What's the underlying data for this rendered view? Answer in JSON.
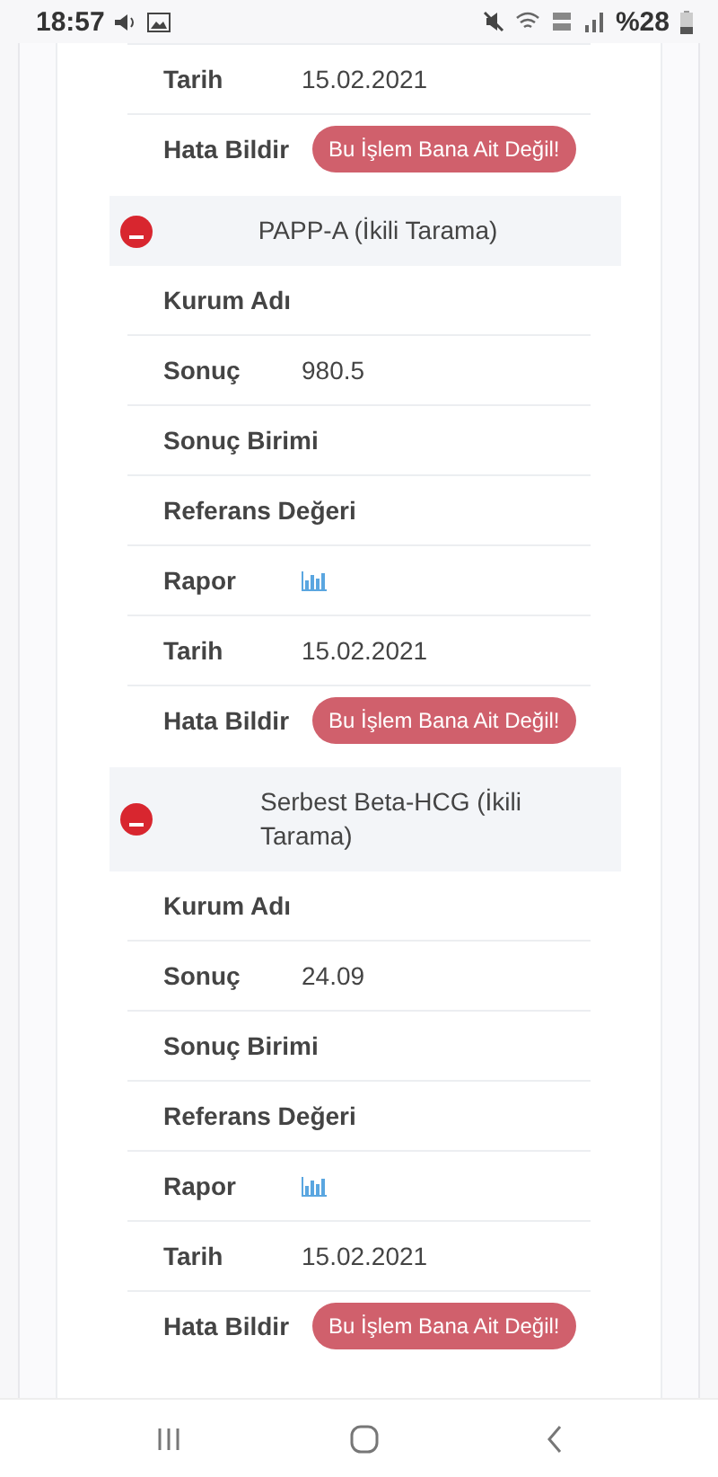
{
  "status_bar": {
    "time": "18:57",
    "battery": "%28"
  },
  "sections": [
    {
      "rows": [
        {
          "kind": "text",
          "label": "Tarih",
          "value": "15.02.2021"
        },
        {
          "kind": "button",
          "label": "Hata Bildir",
          "value": "Bu İşlem Bana Ait Değil!"
        }
      ]
    },
    {
      "title": "PAPP-A (İkili Tarama)",
      "expanded": true,
      "rows": [
        {
          "kind": "text",
          "label": "Kurum Adı",
          "value": null
        },
        {
          "kind": "text",
          "label": "Sonuç",
          "value": "980.5"
        },
        {
          "kind": "text",
          "label": "Sonuç Birimi",
          "value": null
        },
        {
          "kind": "text",
          "label": "Referans Değeri",
          "value": null
        },
        {
          "kind": "chart",
          "label": "Rapor",
          "value": null
        },
        {
          "kind": "text",
          "label": "Tarih",
          "value": "15.02.2021"
        },
        {
          "kind": "button",
          "label": "Hata Bildir",
          "value": "Bu İşlem Bana Ait Değil!"
        }
      ]
    },
    {
      "title": "Serbest Beta-HCG (İkili Tarama)",
      "expanded": true,
      "rows": [
        {
          "kind": "text",
          "label": "Kurum Adı",
          "value": null
        },
        {
          "kind": "text",
          "label": "Sonuç",
          "value": "24.09"
        },
        {
          "kind": "text",
          "label": "Sonuç Birimi",
          "value": null
        },
        {
          "kind": "text",
          "label": "Referans Değeri",
          "value": null
        },
        {
          "kind": "chart",
          "label": "Rapor",
          "value": null
        },
        {
          "kind": "text",
          "label": "Tarih",
          "value": "15.02.2021"
        },
        {
          "kind": "button",
          "label": "Hata Bildir",
          "value": "Bu İşlem Bana Ait Değil!"
        }
      ]
    }
  ]
}
